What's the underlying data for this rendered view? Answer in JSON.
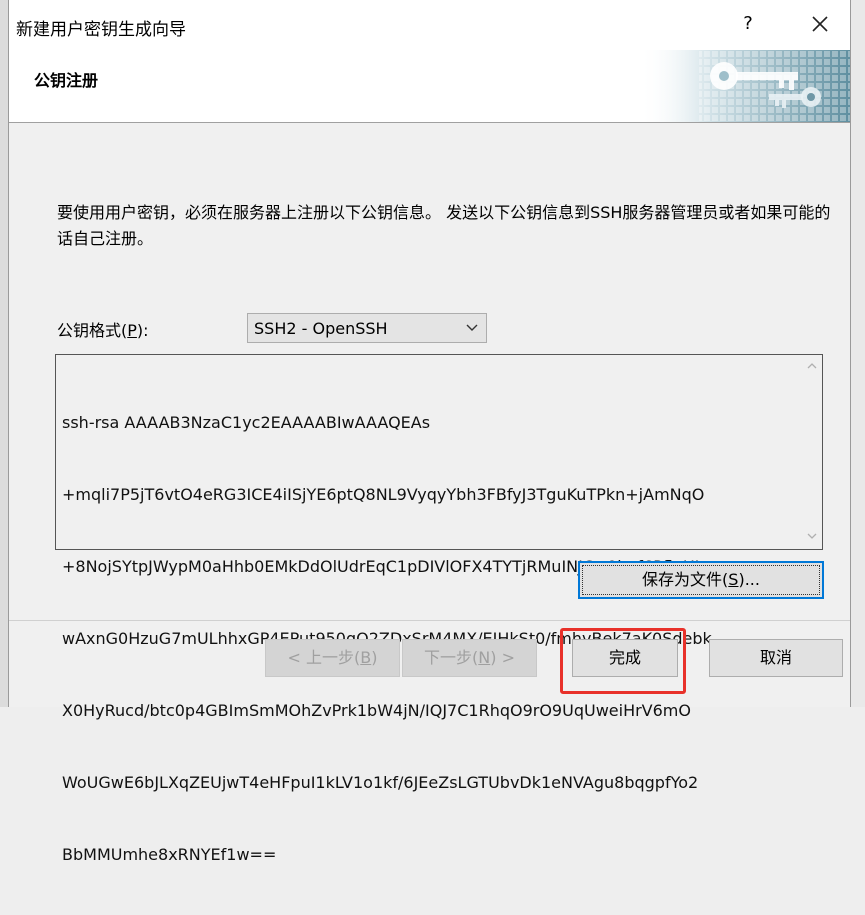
{
  "window": {
    "title": "新建用户密钥生成向导",
    "help_label": "?"
  },
  "header": {
    "title": "公钥注册"
  },
  "content": {
    "description": "要使用用户密钥，必须在服务器上注册以下公钥信息。 发送以下公钥信息到SSH服务器管理员或者如果可能的话自己注册。",
    "format_label_prefix": "公钥格式(",
    "format_label_key": "P",
    "format_label_suffix": "):",
    "format_value": "SSH2 - OpenSSH",
    "public_key_lines": [
      "ssh-rsa AAAAB3NzaC1yc2EAAAABIwAAAQEAs",
      "+mqli7P5jT6vtO4eRG3ICE4iISjYE6ptQ8NL9VyqyYbh3FBfyJ3TguKuTPkn+jAmNqO",
      "+8NojSYtpJWypM0aHhb0EMkDdOlUdrEqC1pDIVlOFX4TYTjRMuINJCw9hef6PfluUI",
      "wAxnG0HzuG7mULhhxGP4EPut950gQ2ZDxSrM4MX/EIHkSt0/fmhvBek7aK0Sdebk",
      "X0HyRucd/btc0p4GBImSmMOhZvPrk1bW4jN/IQJ7C1RhqO9rO9UqUweiHrV6mO",
      "WoUGwE6bJLXqZEUjwT4eHFpuI1kLV1o1kf/6JEeZsLGTUbvDk1eNVAgu8bqgpfYo2",
      "BbMMUmhe8xRNYEf1w=="
    ],
    "save_label_prefix": "保存为文件(",
    "save_label_key": "S",
    "save_label_suffix": ")..."
  },
  "footer": {
    "back_prefix": "< 上一步(",
    "back_key": "B",
    "back_suffix": ")",
    "next_prefix": "下一步(",
    "next_key": "N",
    "next_suffix": ") >",
    "finish_label": "完成",
    "cancel_label": "取消"
  },
  "colors": {
    "highlight": "#e8312a",
    "focus_border": "#0078d7"
  }
}
